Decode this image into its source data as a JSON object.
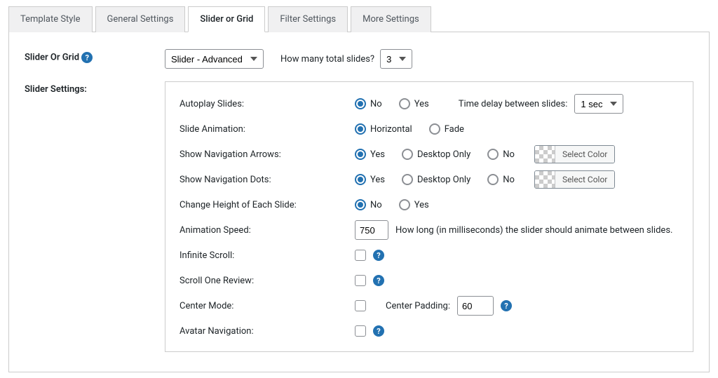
{
  "tabs": {
    "template_style": "Template Style",
    "general_settings": "General Settings",
    "slider_or_grid": "Slider or Grid",
    "filter_settings": "Filter Settings",
    "more_settings": "More Settings"
  },
  "slider_or_grid": {
    "label": "Slider Or Grid",
    "select_value": "Slider - Advanced",
    "slides_question": "How many total slides?",
    "slides_value": "3"
  },
  "slider_settings": {
    "section_label": "Slider Settings:",
    "autoplay": {
      "label": "Autoplay Slides:",
      "no": "No",
      "yes": "Yes",
      "delay_label": "Time delay between slides:",
      "delay_value": "1 sec"
    },
    "animation": {
      "label": "Slide Animation:",
      "horizontal": "Horizontal",
      "fade": "Fade"
    },
    "nav_arrows": {
      "label": "Show Navigation Arrows:",
      "yes": "Yes",
      "desktop_only": "Desktop Only",
      "no": "No",
      "select_color": "Select Color"
    },
    "nav_dots": {
      "label": "Show Navigation Dots:",
      "yes": "Yes",
      "desktop_only": "Desktop Only",
      "no": "No",
      "select_color": "Select Color"
    },
    "change_height": {
      "label": "Change Height of Each Slide:",
      "no": "No",
      "yes": "Yes"
    },
    "speed": {
      "label": "Animation Speed:",
      "value": "750",
      "hint": "How long (in milliseconds) the slider should animate between slides."
    },
    "infinite": {
      "label": "Infinite Scroll:"
    },
    "scroll_one": {
      "label": "Scroll One Review:"
    },
    "center": {
      "label": "Center Mode:",
      "padding_label": "Center Padding:",
      "padding_value": "60"
    },
    "avatar_nav": {
      "label": "Avatar Navigation:"
    }
  }
}
